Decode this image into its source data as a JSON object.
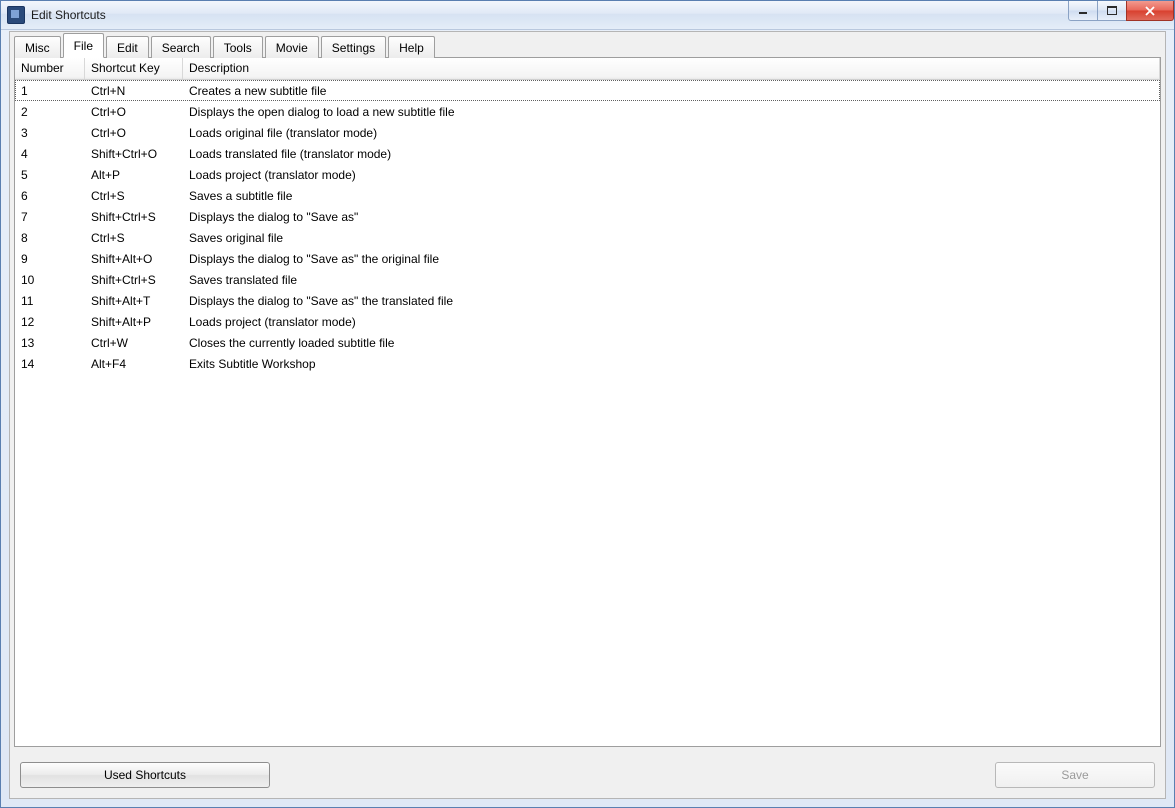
{
  "window": {
    "title": "Edit Shortcuts"
  },
  "tabs": [
    {
      "label": "Misc"
    },
    {
      "label": "File"
    },
    {
      "label": "Edit"
    },
    {
      "label": "Search"
    },
    {
      "label": "Tools"
    },
    {
      "label": "Movie"
    },
    {
      "label": "Settings"
    },
    {
      "label": "Help"
    }
  ],
  "active_tab_index": 1,
  "columns": {
    "number": "Number",
    "shortcut": "Shortcut Key",
    "description": "Description"
  },
  "rows": [
    {
      "n": "1",
      "key": "Ctrl+N",
      "desc": "Creates a new subtitle file"
    },
    {
      "n": "2",
      "key": "Ctrl+O",
      "desc": "Displays the open dialog to load a new subtitle file"
    },
    {
      "n": "3",
      "key": "Ctrl+O",
      "desc": "Loads original file (translator mode)"
    },
    {
      "n": "4",
      "key": "Shift+Ctrl+O",
      "desc": "Loads translated file (translator mode)"
    },
    {
      "n": "5",
      "key": "Alt+P",
      "desc": "Loads project (translator mode)"
    },
    {
      "n": "6",
      "key": "Ctrl+S",
      "desc": "Saves a subtitle file"
    },
    {
      "n": "7",
      "key": "Shift+Ctrl+S",
      "desc": "Displays the dialog to \"Save as\""
    },
    {
      "n": "8",
      "key": "Ctrl+S",
      "desc": "Saves original file"
    },
    {
      "n": "9",
      "key": "Shift+Alt+O",
      "desc": "Displays the dialog to \"Save as\" the original file"
    },
    {
      "n": "10",
      "key": "Shift+Ctrl+S",
      "desc": "Saves translated file"
    },
    {
      "n": "11",
      "key": "Shift+Alt+T",
      "desc": "Displays the dialog to \"Save as\" the translated file"
    },
    {
      "n": "12",
      "key": "Shift+Alt+P",
      "desc": "Loads project (translator mode)"
    },
    {
      "n": "13",
      "key": "Ctrl+W",
      "desc": "Closes the currently loaded subtitle file"
    },
    {
      "n": "14",
      "key": "Alt+F4",
      "desc": "Exits Subtitle Workshop"
    }
  ],
  "selected_row_index": 0,
  "buttons": {
    "used": "Used Shortcuts",
    "save": "Save"
  }
}
